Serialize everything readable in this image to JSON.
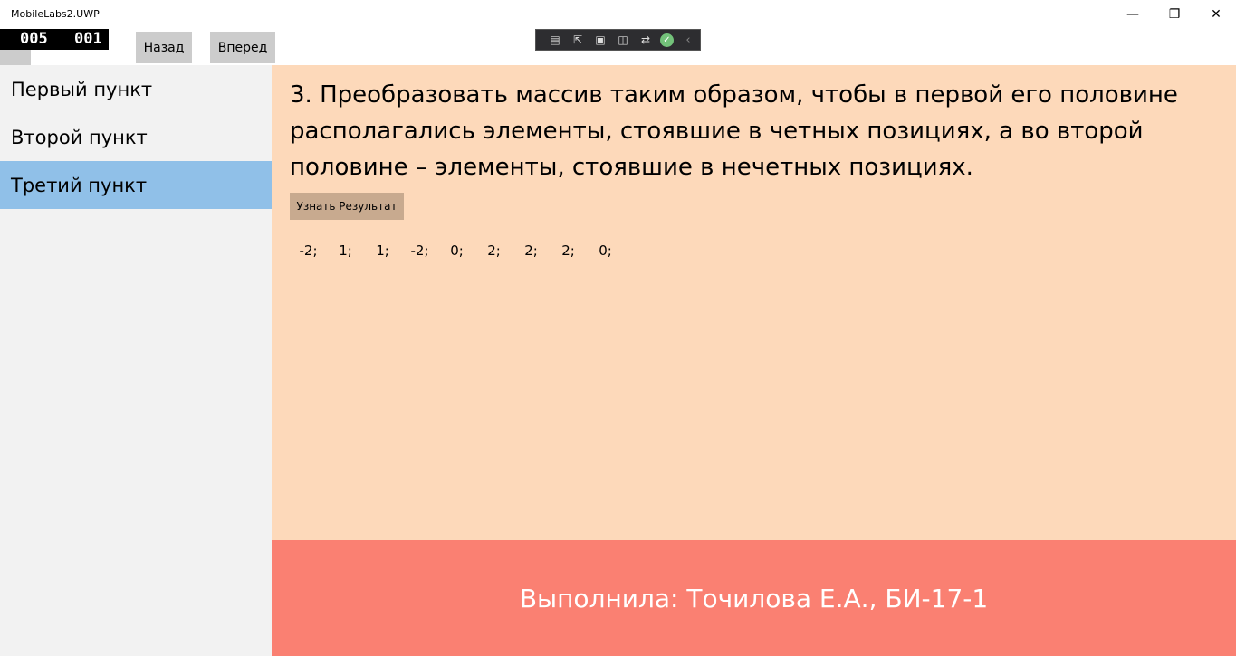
{
  "window": {
    "title": "MobileLabs2.UWP",
    "minimize_glyph": "—",
    "maximize_glyph": "❐",
    "close_glyph": "✕"
  },
  "counter": {
    "left": "005",
    "right": "001"
  },
  "nav": {
    "back_label": "Назад",
    "forward_label": "Вперед"
  },
  "sidebar": {
    "items": [
      {
        "label": "Первый пункт",
        "selected": false
      },
      {
        "label": "Второй пункт",
        "selected": false
      },
      {
        "label": "Третий пункт",
        "selected": true
      }
    ]
  },
  "main": {
    "task_text": "3. Преобразовать массив таким образом, чтобы в первой его половине располагались элементы, стоявшие в четных позициях, а во второй половине – элементы, стоявшие в нечетных позициях.",
    "result_button_label": "Узнать Результат",
    "result_values": [
      "-2;",
      "1;",
      "1;",
      "-2;",
      "0;",
      "2;",
      "2;",
      "2;",
      "0;"
    ]
  },
  "footer": {
    "text": "Выполнила: Точилова Е.А., БИ-17-1"
  },
  "colors": {
    "sidebar_bg": "#f2f2f2",
    "selected_item": "#90c0e8",
    "content_bg": "#fdd9ba",
    "result_button": "#c8aa8f",
    "footer_bg": "#fa8072"
  }
}
